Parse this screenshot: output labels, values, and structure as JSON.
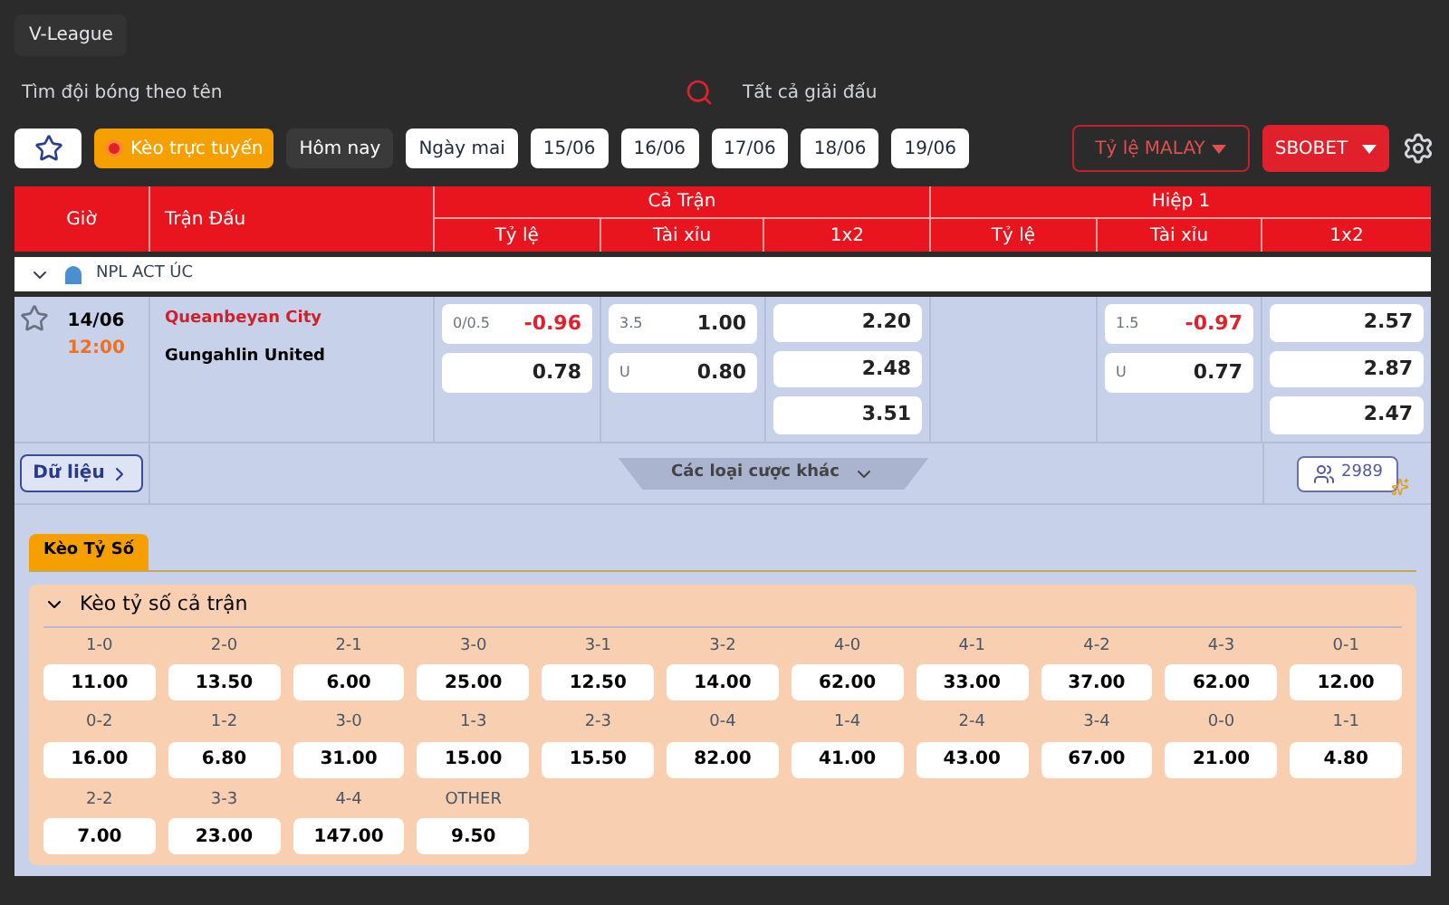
{
  "league_tab": "V-League",
  "search": {
    "placeholder": "Tìm đội bóng theo tên"
  },
  "league_filter": "Tất cả giải đấu",
  "filters": [
    {
      "kind": "star",
      "selected": false
    },
    {
      "kind": "live",
      "label": "Kèo trực tuyến",
      "on": true
    },
    {
      "kind": "date",
      "label": "Hôm nay",
      "selected": true
    },
    {
      "kind": "date",
      "label": "Ngày mai",
      "selected": false
    },
    {
      "kind": "date",
      "label": "15/06",
      "selected": false
    },
    {
      "kind": "date",
      "label": "16/06",
      "selected": false
    },
    {
      "kind": "date",
      "label": "17/06",
      "selected": false
    },
    {
      "kind": "date",
      "label": "18/06",
      "selected": false
    },
    {
      "kind": "date",
      "label": "19/06",
      "selected": false
    }
  ],
  "odds_type": "Tỷ lệ MALAY",
  "bookmaker": "SBOBET",
  "table": {
    "col_time": "Giờ",
    "col_match": "Trận Đấu",
    "groups": [
      {
        "title": "Cả Trận",
        "columns": [
          "Tỷ lệ",
          "Tài xỉu",
          "1x2"
        ]
      },
      {
        "title": "Hiệp 1",
        "columns": [
          "Tỷ lệ",
          "Tài xỉu",
          "1x2"
        ]
      }
    ],
    "league": "NPL ACT ÚC",
    "match": {
      "favorite": false,
      "date": "14/06",
      "time": "12:00",
      "home": "Queanbeyan City",
      "away": "Gungahlin United",
      "odds": [
        {
          "kind": "cells",
          "cells": [
            {
              "line": "0/0.5",
              "value": "-0.96",
              "negative": true
            },
            {
              "value": "0.78",
              "negative": false
            }
          ]
        },
        {
          "kind": "cells",
          "cells": [
            {
              "line": "3.5",
              "value": "1.00",
              "negative": false
            },
            {
              "line": "U",
              "value": "0.80",
              "negative": false
            }
          ]
        },
        {
          "kind": "cells",
          "cells": [
            {
              "value": "2.20",
              "negative": false
            },
            {
              "value": "2.48",
              "negative": false
            },
            {
              "value": "3.51",
              "negative": false
            }
          ]
        },
        {
          "kind": "blank"
        },
        {
          "kind": "cells",
          "cells": [
            {
              "line": "1.5",
              "value": "-0.97",
              "negative": true
            },
            {
              "line": "U",
              "value": "0.77",
              "negative": false
            }
          ]
        },
        {
          "kind": "cells",
          "cells": [
            {
              "value": "2.57",
              "negative": false
            },
            {
              "value": "2.87",
              "negative": false
            },
            {
              "value": "2.47",
              "negative": false
            }
          ]
        }
      ],
      "data_button": "Dữ liệu",
      "more_bets": "Các loại cược khác",
      "viewers": "2989"
    }
  },
  "score_tab": {
    "label": "Kèo Tỷ Số",
    "selected": true
  },
  "score_section": {
    "title": "Kèo tỷ số cả trận",
    "expanded": true,
    "items": [
      {
        "score": "1-0",
        "odds": "11.00"
      },
      {
        "score": "2-0",
        "odds": "13.50"
      },
      {
        "score": "2-1",
        "odds": "6.00"
      },
      {
        "score": "3-0",
        "odds": "25.00"
      },
      {
        "score": "3-1",
        "odds": "12.50"
      },
      {
        "score": "3-2",
        "odds": "14.00"
      },
      {
        "score": "4-0",
        "odds": "62.00"
      },
      {
        "score": "4-1",
        "odds": "33.00"
      },
      {
        "score": "4-2",
        "odds": "37.00"
      },
      {
        "score": "4-3",
        "odds": "62.00"
      },
      {
        "score": "0-1",
        "odds": "12.00"
      },
      {
        "score": "0-2",
        "odds": "16.00"
      },
      {
        "score": "1-2",
        "odds": "6.80"
      },
      {
        "score": "3-0",
        "odds": "31.00"
      },
      {
        "score": "1-3",
        "odds": "15.00"
      },
      {
        "score": "2-3",
        "odds": "15.50"
      },
      {
        "score": "0-4",
        "odds": "82.00"
      },
      {
        "score": "1-4",
        "odds": "41.00"
      },
      {
        "score": "2-4",
        "odds": "43.00"
      },
      {
        "score": "3-4",
        "odds": "67.00"
      },
      {
        "score": "0-0",
        "odds": "21.00"
      },
      {
        "score": "1-1",
        "odds": "4.80"
      },
      {
        "score": "2-2",
        "odds": "7.00"
      },
      {
        "score": "3-3",
        "odds": "23.00"
      },
      {
        "score": "4-4",
        "odds": "147.00"
      },
      {
        "score": "OTHER",
        "odds": "9.50"
      }
    ]
  }
}
